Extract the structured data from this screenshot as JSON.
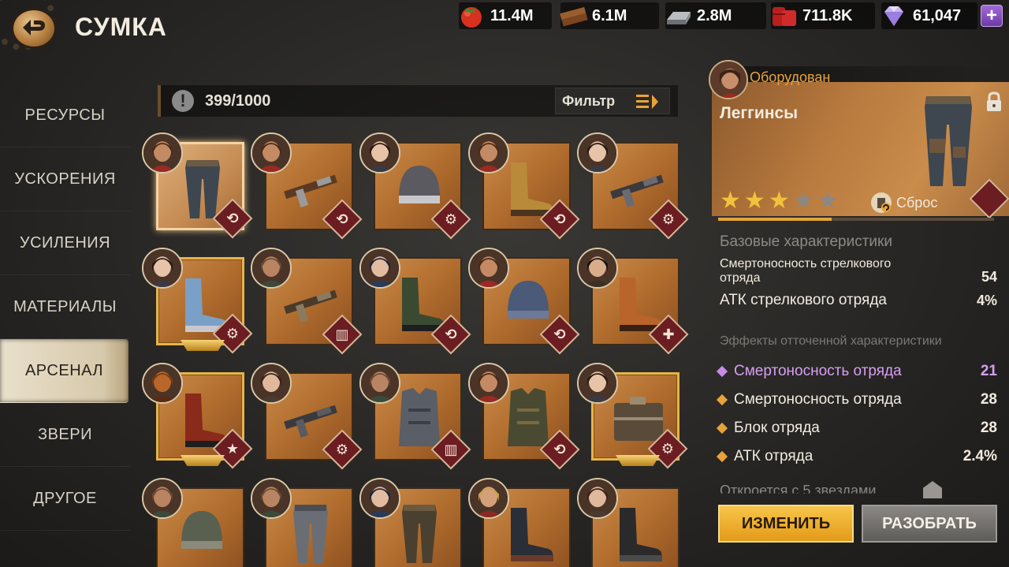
{
  "header": {
    "title": "СУМКА",
    "resources": [
      {
        "name": "food",
        "value": "11.4M",
        "icon": "tomato-icon"
      },
      {
        "name": "wood",
        "value": "6.1M",
        "icon": "wood-planks-icon"
      },
      {
        "name": "steel",
        "value": "2.8M",
        "icon": "steel-ingot-icon"
      },
      {
        "name": "oil",
        "value": "711.8K",
        "icon": "oil-barrel-icon"
      },
      {
        "name": "diamonds",
        "value": "61,047",
        "icon": "diamond-icon"
      }
    ],
    "plus": "+"
  },
  "sidebar": {
    "items": [
      {
        "label": "РЕСУРСЫ",
        "active": false
      },
      {
        "label": "УСКОРЕНИЯ",
        "active": false
      },
      {
        "label": "УСИЛЕНИЯ",
        "active": false
      },
      {
        "label": "МАТЕРИАЛЫ",
        "active": false
      },
      {
        "label": "АРСЕНАЛ",
        "active": true
      },
      {
        "label": "ЗВЕРИ",
        "active": false
      },
      {
        "label": "ДРУГОЕ",
        "active": false
      }
    ]
  },
  "inventory": {
    "capacity": "399/1000",
    "filter_label": "Фильтр",
    "items": [
      {
        "item": "leggings",
        "owner": "man-bandana",
        "tier": "normal",
        "selected": true,
        "badge": "convert"
      },
      {
        "item": "crossbow",
        "owner": "man-bandana",
        "tier": "normal",
        "badge": "convert"
      },
      {
        "item": "helmet-goggles",
        "owner": "woman-dark-hair",
        "tier": "normal",
        "badge": "motorcycle"
      },
      {
        "item": "boots-brown",
        "owner": "man-bandana",
        "tier": "normal",
        "badge": "convert"
      },
      {
        "item": "smg",
        "owner": "woman-dark-hair",
        "tier": "normal",
        "badge": "motorcycle"
      },
      {
        "item": "boots-blue",
        "owner": "woman-dark-hair",
        "tier": "gold",
        "badge": "motorcycle"
      },
      {
        "item": "rifle",
        "owner": "man-bald",
        "tier": "normal",
        "badge": "tank"
      },
      {
        "item": "boots-green",
        "owner": "woman-hat",
        "tier": "normal",
        "badge": "convert"
      },
      {
        "item": "beanie",
        "owner": "man-bandana",
        "tier": "normal",
        "badge": "convert"
      },
      {
        "item": "boots-orange",
        "owner": "woman-short-hair",
        "tier": "normal",
        "badge": "medic"
      },
      {
        "item": "boots-red",
        "owner": "man-beast",
        "tier": "gold",
        "badge": "star"
      },
      {
        "item": "assault-rifle",
        "owner": "woman-long-hair",
        "tier": "normal",
        "badge": "motorcycle"
      },
      {
        "item": "vest",
        "owner": "man-bald",
        "tier": "normal",
        "badge": "tank"
      },
      {
        "item": "jacket",
        "owner": "man-bandana",
        "tier": "normal",
        "badge": "convert"
      },
      {
        "item": "case",
        "owner": "woman-dark-hair",
        "tier": "gold",
        "badge": "motorcycle"
      },
      {
        "item": "helmet-army",
        "owner": "man-bald",
        "tier": "normal",
        "badge": ""
      },
      {
        "item": "pants-grey",
        "owner": "man-bald",
        "tier": "normal",
        "badge": ""
      },
      {
        "item": "pants-cargo",
        "owner": "woman-hat",
        "tier": "normal",
        "badge": ""
      },
      {
        "item": "boots-black",
        "owner": "man-blond",
        "tier": "normal",
        "badge": ""
      },
      {
        "item": "rubber-boots",
        "owner": "woman-long-hair",
        "tier": "normal",
        "badge": ""
      }
    ]
  },
  "detail": {
    "equipped_label": "Оборудован",
    "name": "Леггинсы",
    "stars": 3,
    "stars_max": 5,
    "reset_label": "Сброс",
    "level_progress": 0.41,
    "base_title": "Базовые характеристики",
    "base_stats": [
      {
        "name": "Смертоносность стрелкового отряда",
        "value": "54"
      },
      {
        "name": "АТК стрелкового отряда",
        "value": "4%"
      }
    ],
    "refined_title": "Эффекты отточенной характеристики",
    "refined_stats": [
      {
        "name": "Смертоносность отряда",
        "value": "21",
        "color": "#d79ff2"
      },
      {
        "name": "Смертоносность отряда",
        "value": "28",
        "color": "#e8a23a"
      },
      {
        "name": "Блок отряда",
        "value": "28",
        "color": "#e8a23a"
      },
      {
        "name": "АТК отряда",
        "value": "2.4%",
        "color": "#e8a23a"
      }
    ],
    "unlock_text": "Откроется с 5 звездами",
    "change_button": "ИЗМЕНИТЬ",
    "disassemble_button": "РАЗОБРАТЬ"
  }
}
